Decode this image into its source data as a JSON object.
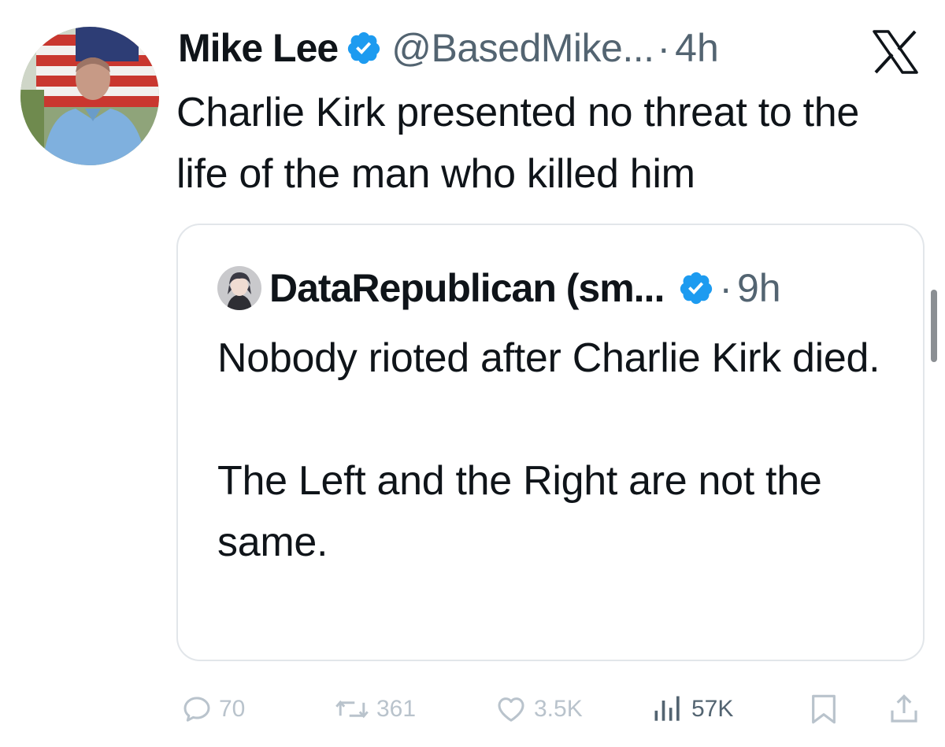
{
  "tweet": {
    "author_name": "Mike Lee",
    "author_handle": "@BasedMike...",
    "separator": "·",
    "time": "4h",
    "text": "Charlie Kirk presented no threat to the life of the man who killed him"
  },
  "quote": {
    "author_name": "DataRepublican (sm...",
    "separator": "·",
    "time": "9h",
    "paragraph_1": "Nobody rioted after Charlie Kirk died.",
    "paragraph_2": "The Left and the Right are not the same."
  },
  "actions": {
    "replies": "70",
    "reposts": "361",
    "likes": "3.5K",
    "views": "57K"
  },
  "icons": {
    "verified": "verified-badge-icon",
    "x_logo": "x-logo-icon",
    "reply": "reply-icon",
    "repost": "repost-icon",
    "like": "heart-icon",
    "views": "views-icon",
    "bookmark": "bookmark-icon",
    "share": "share-icon"
  },
  "colors": {
    "verified_blue": "#1d9bf0",
    "text_primary": "#0f1419",
    "text_secondary": "#536471",
    "action_faded": "#b9c3cc",
    "card_border": "#e2e6ea"
  }
}
